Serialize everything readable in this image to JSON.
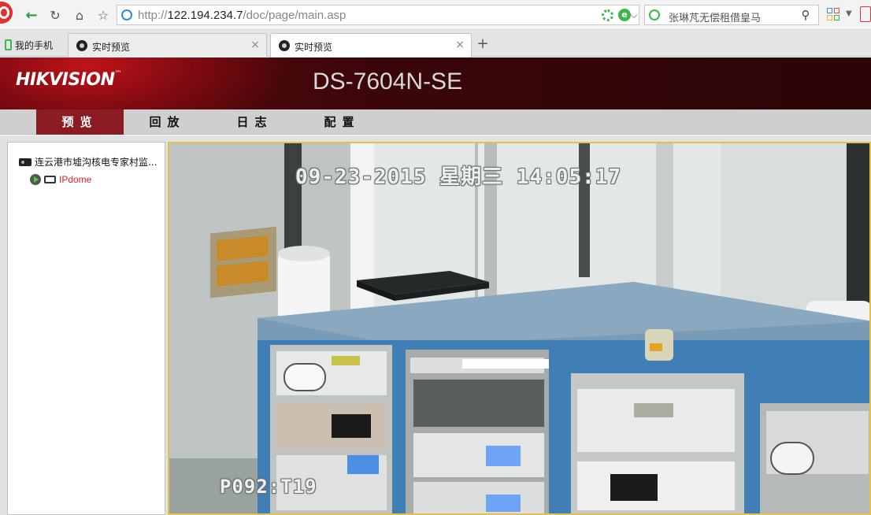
{
  "browser": {
    "url_prefix": "http://",
    "url_host": "122.194.234.7",
    "url_path": "/doc/page/main.asp",
    "search_text": "张琳芃无偿租借皇马",
    "bookmark_label": "我的手机",
    "tabs": [
      {
        "title": "实时预览",
        "active": false
      },
      {
        "title": "实时预览",
        "active": true
      }
    ],
    "close_glyph": "×",
    "newtab_glyph": "+"
  },
  "header": {
    "brand": "HIKVISION",
    "brand_mark": "™",
    "model": "DS-7604N-SE"
  },
  "nav": {
    "items": [
      {
        "label": "预览",
        "active": true
      },
      {
        "label": "回放",
        "active": false
      },
      {
        "label": "日志",
        "active": false
      },
      {
        "label": "配置",
        "active": false
      }
    ]
  },
  "tree": {
    "root_label": "连云港市墟沟核电专家村监...",
    "child_label": "IPdome"
  },
  "video": {
    "osd_datetime": "09-23-2015 星期三 14:05:17",
    "osd_channel": "P092:T19"
  },
  "colors": {
    "nav_active": "#8b1c23",
    "camera_label": "#e21f1f",
    "video_border": "#e3c14b"
  }
}
